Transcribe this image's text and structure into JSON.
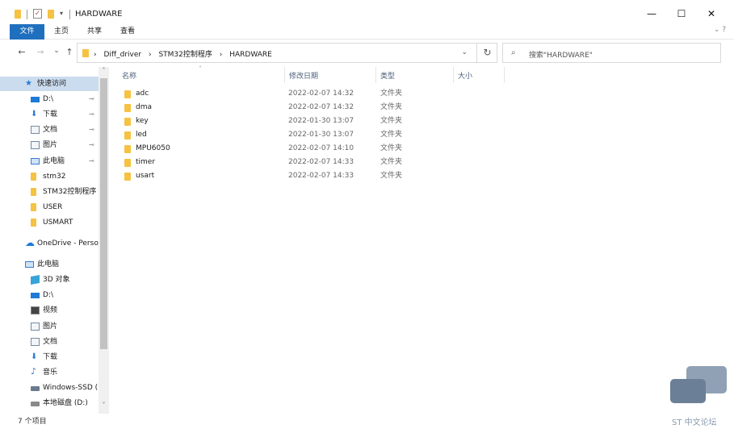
{
  "window": {
    "title": "HARDWARE",
    "minimize_glyph": "—",
    "maximize_glyph": "☐",
    "close_glyph": "✕"
  },
  "ribbon": {
    "tabs": [
      "文件",
      "主页",
      "共享",
      "查看"
    ],
    "help_glyph": "⌄ ?"
  },
  "nav": {
    "back": "←",
    "forward": "→",
    "recent": "⌄",
    "up": "↑"
  },
  "address": {
    "crumbs": [
      "›",
      "Diff_driver",
      "›",
      "STM32控制程序",
      "›",
      "HARDWARE"
    ],
    "dropdown": "⌄",
    "refresh": "↻"
  },
  "search": {
    "placeholder": "搜索\"HARDWARE\"",
    "icon": "search-icon"
  },
  "sidebar": {
    "items": [
      {
        "label": "快速访问",
        "icon": "star-icon",
        "pinned": false,
        "indent": 1,
        "selected": true,
        "color": "#2b7bd4"
      },
      {
        "label": "D:\\",
        "icon": "drive-icon",
        "pinned": true,
        "indent": 2,
        "color": "#1e7ad6"
      },
      {
        "label": "下载",
        "icon": "download-icon",
        "pinned": true,
        "indent": 2,
        "color": "#2b7bd4"
      },
      {
        "label": "文档",
        "icon": "document-icon",
        "pinned": true,
        "indent": 2,
        "color": "#7a8aa0"
      },
      {
        "label": "图片",
        "icon": "pictures-icon",
        "pinned": true,
        "indent": 2,
        "color": "#6e8aa8"
      },
      {
        "label": "此电脑",
        "icon": "computer-icon",
        "pinned": true,
        "indent": 2,
        "color": "#3a7bd0"
      },
      {
        "label": "stm32",
        "icon": "folder-icon",
        "pinned": false,
        "indent": 2,
        "color": "#f5c242"
      },
      {
        "label": "STM32控制程序",
        "icon": "folder-icon",
        "pinned": false,
        "indent": 2,
        "color": "#f5c242"
      },
      {
        "label": "USER",
        "icon": "folder-icon",
        "pinned": false,
        "indent": 2,
        "color": "#f5c242"
      },
      {
        "label": "USMART",
        "icon": "folder-icon",
        "pinned": false,
        "indent": 2,
        "color": "#f5c242"
      },
      {
        "label": "OneDrive - Perso",
        "icon": "cloud-icon",
        "pinned": false,
        "indent": 1,
        "color": "#1e7ad6"
      },
      {
        "label": "此电脑",
        "icon": "computer-icon",
        "pinned": false,
        "indent": 1,
        "color": "#3a7bd0"
      },
      {
        "label": "3D 对象",
        "icon": "cube-icon",
        "pinned": false,
        "indent": 2,
        "color": "#38a3d8"
      },
      {
        "label": "D:\\",
        "icon": "drive-icon",
        "pinned": false,
        "indent": 2,
        "color": "#1e7ad6"
      },
      {
        "label": "视频",
        "icon": "video-icon",
        "pinned": false,
        "indent": 2,
        "color": "#555555"
      },
      {
        "label": "图片",
        "icon": "pictures-icon",
        "pinned": false,
        "indent": 2,
        "color": "#6e8aa8"
      },
      {
        "label": "文档",
        "icon": "document-icon",
        "pinned": false,
        "indent": 2,
        "color": "#7a8aa0"
      },
      {
        "label": "下载",
        "icon": "download-icon",
        "pinned": false,
        "indent": 2,
        "color": "#2b7bd4"
      },
      {
        "label": "音乐",
        "icon": "music-icon",
        "pinned": false,
        "indent": 2,
        "color": "#2b7bd4"
      },
      {
        "label": "Windows-SSD (",
        "icon": "ssd-icon",
        "pinned": false,
        "indent": 2,
        "color": "#6a7b8c"
      },
      {
        "label": "本地磁盘 (D:)",
        "icon": "disk-icon",
        "pinned": false,
        "indent": 2,
        "color": "#8a8a8a"
      }
    ],
    "pin_glyph": "📌"
  },
  "columns": {
    "name": "名称",
    "date": "修改日期",
    "type": "类型",
    "size": "大小",
    "sort_glyph": "˄"
  },
  "files": [
    {
      "name": "adc",
      "date": "2022-02-07 14:32",
      "type": "文件夹"
    },
    {
      "name": "dma",
      "date": "2022-02-07 14:32",
      "type": "文件夹"
    },
    {
      "name": "key",
      "date": "2022-01-30 13:07",
      "type": "文件夹"
    },
    {
      "name": "led",
      "date": "2022-01-30 13:07",
      "type": "文件夹"
    },
    {
      "name": "MPU6050",
      "date": "2022-02-07 14:10",
      "type": "文件夹"
    },
    {
      "name": "timer",
      "date": "2022-02-07 14:33",
      "type": "文件夹"
    },
    {
      "name": "usart",
      "date": "2022-02-07 14:33",
      "type": "文件夹"
    }
  ],
  "status": {
    "count": "7 个项目"
  },
  "watermark": {
    "text": "ST 中文论坛",
    "dots": "•••"
  },
  "colors": {
    "accent": "#1f6fbf",
    "folder": "#f5c242",
    "selection": "#ccdcef"
  }
}
